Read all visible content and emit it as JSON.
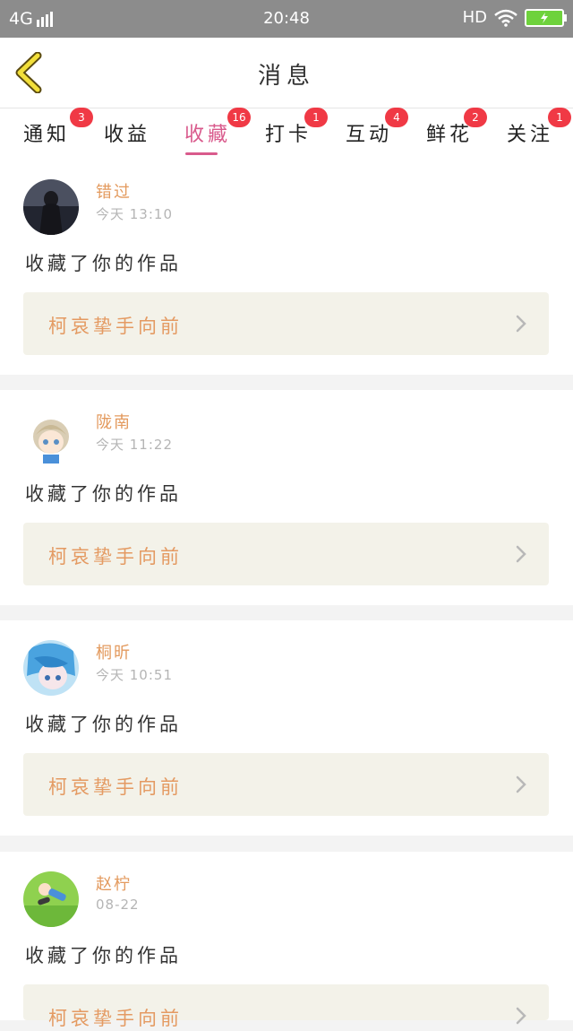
{
  "status_bar": {
    "network": "4G",
    "time": "20:48",
    "hd": "HD"
  },
  "header": {
    "title": "消息",
    "back_icon": "chevron-left-icon"
  },
  "tabs": [
    {
      "label": "通知",
      "badge": "3",
      "active": false
    },
    {
      "label": "收益",
      "badge": "",
      "active": false
    },
    {
      "label": "收藏",
      "badge": "16",
      "active": true
    },
    {
      "label": "打卡",
      "badge": "1",
      "active": false
    },
    {
      "label": "互动",
      "badge": "4",
      "active": false
    },
    {
      "label": "鲜花",
      "badge": "2",
      "active": false
    },
    {
      "label": "关注",
      "badge": "1",
      "active": false
    }
  ],
  "messages": [
    {
      "user": "错过",
      "time": "今天 13:10",
      "action": "收藏了你的作品",
      "work": "柯哀挚手向前"
    },
    {
      "user": "陇南",
      "time": "今天 11:22",
      "action": "收藏了你的作品",
      "work": "柯哀挚手向前"
    },
    {
      "user": "桐昕",
      "time": "今天 10:51",
      "action": "收藏了你的作品",
      "work": "柯哀挚手向前"
    },
    {
      "user": "赵柠",
      "time": "08-22",
      "action": "收藏了你的作品",
      "work": "柯哀挚手向前"
    }
  ],
  "colors": {
    "accent": "#d95a8c",
    "badge": "#f03945",
    "username": "#e39a5e",
    "work_bg": "#f3f2e9"
  }
}
